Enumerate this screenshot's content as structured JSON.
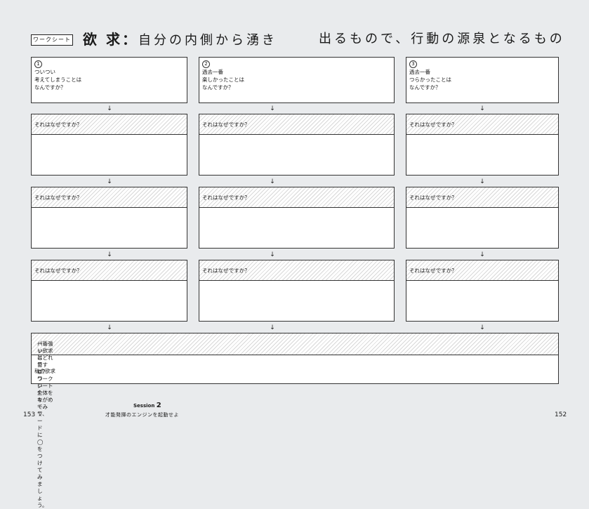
{
  "header": {
    "tag": "ワークシート",
    "title_main": "欲 求：",
    "title_part1": "自分の内側から湧き",
    "title_part2": "出るもので、行動の源泉となるもの"
  },
  "columns": [
    {
      "num": "1",
      "lines": [
        "ついつい",
        "考えてしまうことは",
        "なんですか？"
      ]
    },
    {
      "num": "2",
      "lines": [
        "過去一番",
        "楽しかったことは",
        "なんですか？"
      ]
    },
    {
      "num": "3",
      "lines": [
        "過去一番",
        "つらかったことは",
        "なんですか？"
      ]
    }
  ],
  "why_label": "それはなぜですか？",
  "arrow": "↓",
  "final": {
    "line1": "一番強い欲求はどれですか？　ワークシート全体をながめてみて、",
    "line2": "パッと目についたキーワードに◯をつけてみましょう。",
    "my_desire": "私の欲求"
  },
  "footer": {
    "page_left": "153",
    "page_right": "152",
    "session_label": "Session",
    "session_num": "2",
    "subtitle": "才能発揮のエンジンを起動せよ"
  }
}
